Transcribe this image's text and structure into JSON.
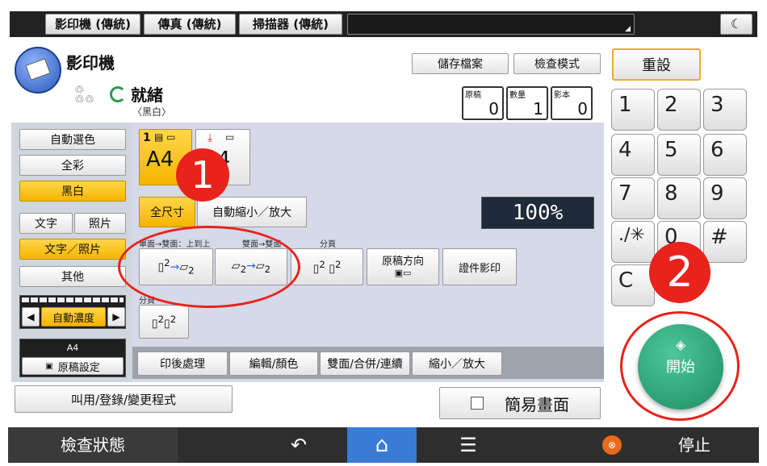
{
  "top_tabs": [
    "影印機 (傳統)",
    "傳真 (傳統)",
    "掃描器 (傳統)"
  ],
  "header": {
    "title": "影印機",
    "store_file": "儲存檔案",
    "check_mode": "檢查模式",
    "reset": "重設"
  },
  "status": {
    "text": "就緒",
    "sub": "〈黑白〉"
  },
  "counters": [
    {
      "label": "原稿",
      "value": "0"
    },
    {
      "label": "數量",
      "value": "1"
    },
    {
      "label": "影本",
      "value": "0"
    }
  ],
  "color_modes": [
    "自動選色",
    "全彩",
    "黑白"
  ],
  "text_photo": {
    "text": "文字",
    "photo": "照片",
    "text_photo": "文字／照片",
    "other": "其他"
  },
  "density": "自動濃度",
  "original_settings": {
    "size": "A4",
    "label": "原稿設定"
  },
  "paper_tray": {
    "tray": "1",
    "size": "A4"
  },
  "bypass_size": "A4",
  "zoom": {
    "full": "全尺寸",
    "auto": "自動縮小／放大",
    "value": "100%"
  },
  "duplex_labels": {
    "one_two": "單面→雙面：上到上",
    "two_two": "雙面→雙面",
    "sort": "分頁",
    "sort2": "分頁"
  },
  "orientation": "原稿方向",
  "id_copy": "證件影印",
  "bottom_tabs": [
    "印後處理",
    "編輯/顏色",
    "雙面/合併/連續",
    "縮小／放大"
  ],
  "recall_program": "叫用/登錄/變更程式",
  "simple_screen": "簡易畫面",
  "keypad": [
    "1",
    "2",
    "3",
    "4",
    "5",
    "6",
    "7",
    "8",
    "9",
    ".∕✳",
    "0",
    "#",
    "C"
  ],
  "start": "開始",
  "annotations": [
    "1",
    "2"
  ],
  "bottom_bar": {
    "check_status": "檢查狀態",
    "stop": "停止"
  },
  "colors": {
    "accent_yellow": "#f5b400",
    "start_green": "#2aa07a",
    "annotation_red": "#e8231c",
    "home_blue": "#3a7bd5"
  }
}
